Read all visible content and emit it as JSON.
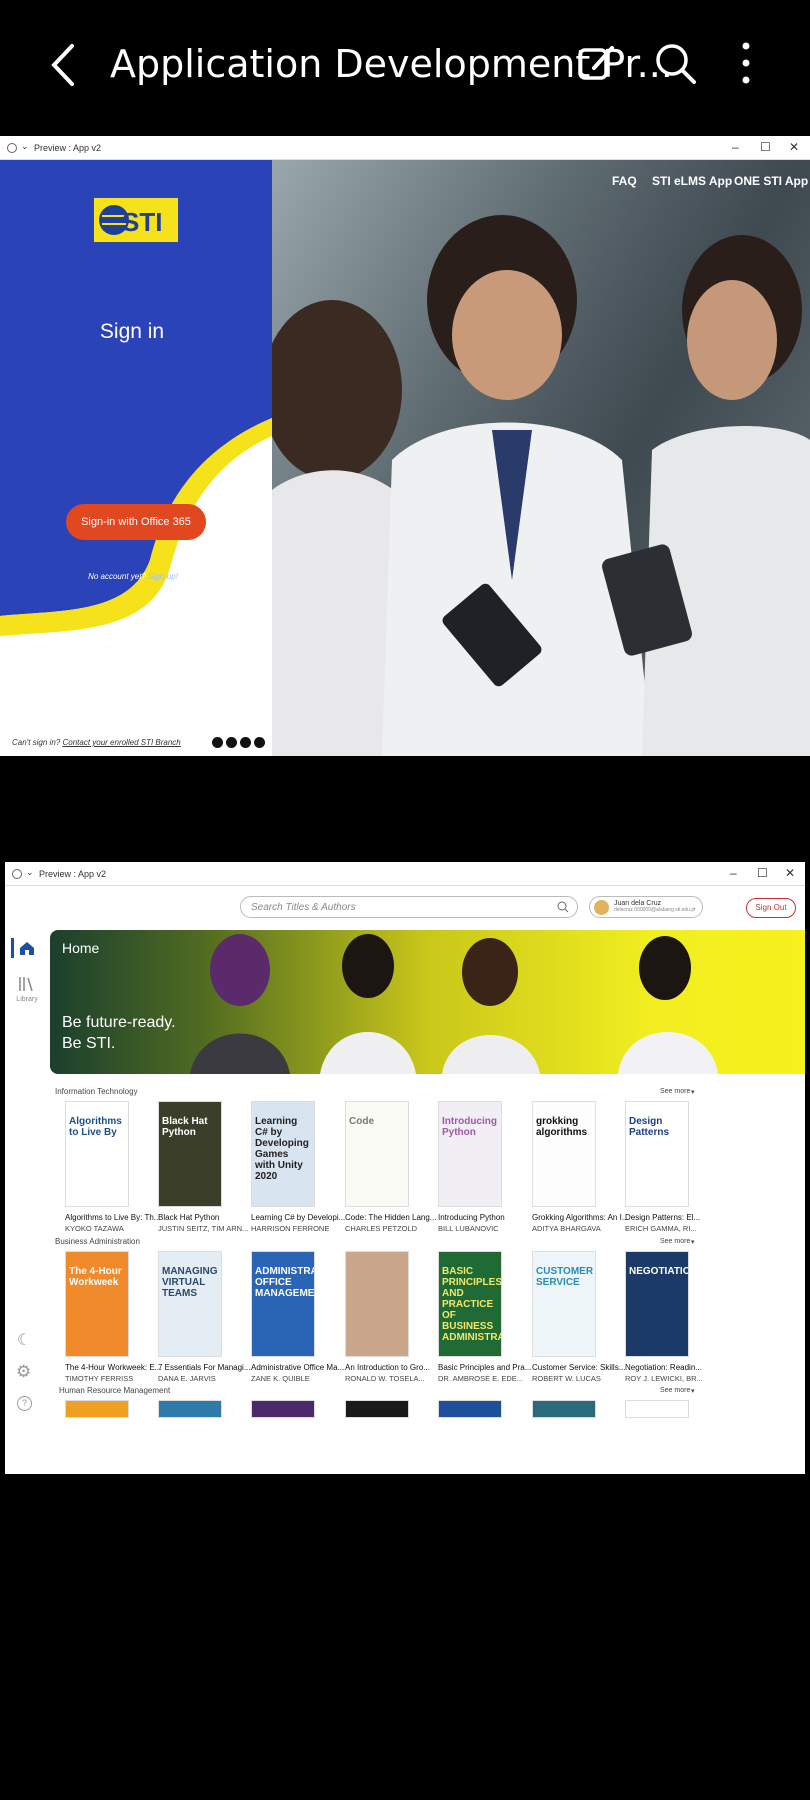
{
  "viewer": {
    "title": "Application Development Pr..."
  },
  "login_window": {
    "title": "Preview : App v2",
    "logo_text": "STI",
    "heading": "Sign in",
    "o365_button": "Sign-in with Office 365",
    "no_account": "No account yet?",
    "signup": "Sign-up!",
    "cant_sign_in": "Can't sign in?",
    "contact_link": "Contact your enrolled STI Branch",
    "nav": [
      "FAQ",
      "STI eLMS App",
      "ONE STI App"
    ],
    "colors": {
      "brand_blue": "#2a43b8",
      "yellow": "#f5e21a",
      "o365": "#e2481f"
    }
  },
  "library_window": {
    "title": "Preview : App v2",
    "search_placeholder": "Search Titles & Authors",
    "user_name": "Juan dela Cruz",
    "user_email": "delacruz.000000@alabang.sti.edu.ph",
    "sign_out": "Sign Out",
    "rail_library": "Library",
    "banner_home": "Home",
    "banner_tag": "Be future-ready. Be STI.",
    "see_more": "See more",
    "sections": [
      {
        "name": "Information Technology",
        "books": [
          {
            "title": "Algorithms to Live By: Th...",
            "author": "KYOKO TAZAWA",
            "cover": "Algorithms to Live By",
            "bg": "#ffffff",
            "fg": "#1c4f8a"
          },
          {
            "title": "Black Hat Python",
            "author": "JUSTIN SEITZ, TIM ARN...",
            "cover": "Black Hat Python",
            "bg": "#3b3f2a",
            "fg": "#ffffff"
          },
          {
            "title": "Learning C# by Developi...",
            "author": "HARRISON FERRONE",
            "cover": "Learning C# by Developing Games with Unity 2020",
            "bg": "#d8e4ef",
            "fg": "#222"
          },
          {
            "title": "Code: The Hidden Lang...",
            "author": "CHARLES PETZOLD",
            "cover": "Code",
            "bg": "#fbfbf6",
            "fg": "#777"
          },
          {
            "title": "Introducing Python",
            "author": "BILL LUBANOVIC",
            "cover": "Introducing Python",
            "bg": "#f1eef4",
            "fg": "#a05aa8"
          },
          {
            "title": "Grokking Algorithms: An I...",
            "author": "ADITYA BHARGAVA",
            "cover": "grokking algorithms",
            "bg": "#fdfdfd",
            "fg": "#111"
          },
          {
            "title": "Design Patterns: El...",
            "author": "ERICH GAMMA, RI...",
            "cover": "Design Patterns",
            "bg": "#ffffff",
            "fg": "#1e3c8c"
          }
        ]
      },
      {
        "name": "Business Administration",
        "books": [
          {
            "title": "The 4-Hour Workweek: E...",
            "author": "TIMOTHY FERRISS",
            "cover": "The 4-Hour Workweek",
            "bg": "#f08a2a",
            "fg": "#ffffff"
          },
          {
            "title": "7 Essentials For Managi...",
            "author": "DANA E. JARVIS",
            "cover": "MANAGING VIRTUAL TEAMS",
            "bg": "#e4edf4",
            "fg": "#2b4a6a"
          },
          {
            "title": "Administrative Office Ma...",
            "author": "ZANE K. QUIBLE",
            "cover": "ADMINISTRATIVE OFFICE MANAGEMENT",
            "bg": "#2a64b5",
            "fg": "#ffffff"
          },
          {
            "title": "An Introduction to Gro...",
            "author": "RONALD W. TOSELA...",
            "cover": "",
            "bg": "#caa68a",
            "fg": "#ffffff"
          },
          {
            "title": "Basic Principles and Pra...",
            "author": "DR. AMBROSE E. EDE...",
            "cover": "BASIC PRINCIPLES AND PRACTICE OF BUSINESS ADMINISTRATION",
            "bg": "#1f6a35",
            "fg": "#f4e66a"
          },
          {
            "title": "Customer Service: Skills...",
            "author": "ROBERT W. LUCAS",
            "cover": "CUSTOMER SERVICE",
            "bg": "#eef6fa",
            "fg": "#2a8ab8"
          },
          {
            "title": "Negotiation: Readin...",
            "author": "ROY J. LEWICKI, BR...",
            "cover": "NEGOTIATION",
            "bg": "#1c3a68",
            "fg": "#ffffff"
          }
        ]
      },
      {
        "name": "Human Resource Management",
        "books": [
          {
            "bg": "#f0a020"
          },
          {
            "bg": "#2f7aa8"
          },
          {
            "bg": "#4a2a6a"
          },
          {
            "bg": "#1a1a1a"
          },
          {
            "bg": "#1e4f9a"
          },
          {
            "bg": "#2a6a7a"
          },
          {
            "bg": "#ffffff"
          }
        ]
      }
    ]
  }
}
